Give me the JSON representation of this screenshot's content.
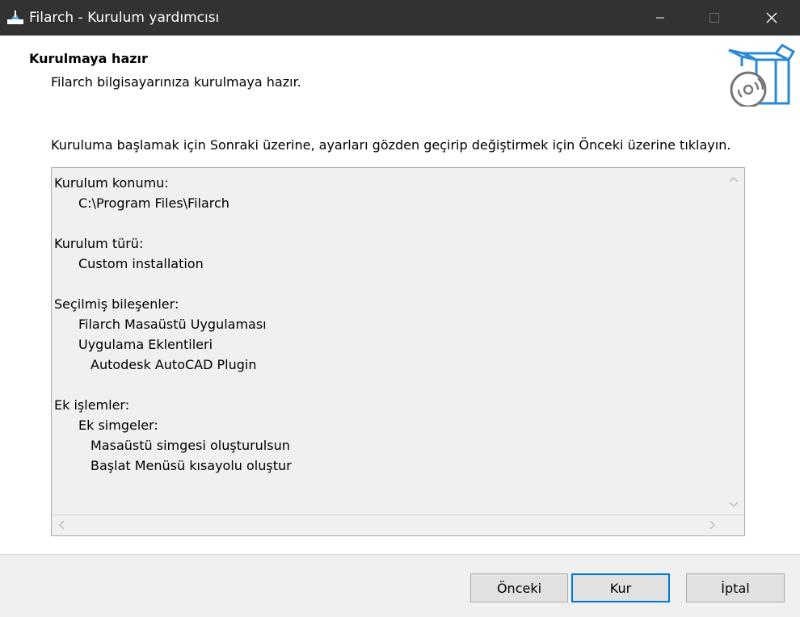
{
  "window": {
    "title": "Filarch - Kurulum yardımcısı",
    "app_icon": "installer-icon",
    "controls": [
      "minimize-icon",
      "maximize-icon",
      "close-icon"
    ]
  },
  "header": {
    "title": "Kurulmaya hazır",
    "subtitle": "Filarch bilgisayarınıza kurulmaya hazır.",
    "icon": "setup-box-cd-icon"
  },
  "content": {
    "instruction": "Kuruluma başlamak için Sonraki üzerine, ayarları gözden geçirip değiştirmek için Önceki üzerine tıklayın.",
    "memo_lines": [
      {
        "indent": 0,
        "text": "Kurulum konumu:"
      },
      {
        "indent": 1,
        "text": "C:\\Program Files\\Filarch"
      },
      {
        "indent": 0,
        "text": ""
      },
      {
        "indent": 0,
        "text": "Kurulum türü:"
      },
      {
        "indent": 1,
        "text": "Custom installation"
      },
      {
        "indent": 0,
        "text": ""
      },
      {
        "indent": 0,
        "text": "Seçilmiş bileşenler:"
      },
      {
        "indent": 1,
        "text": "Filarch Masaüstü Uygulaması"
      },
      {
        "indent": 1,
        "text": "Uygulama Eklentileri"
      },
      {
        "indent": 2,
        "text": "Autodesk AutoCAD Plugin"
      },
      {
        "indent": 0,
        "text": ""
      },
      {
        "indent": 0,
        "text": "Ek işlemler:"
      },
      {
        "indent": 1,
        "text": "Ek simgeler:"
      },
      {
        "indent": 2,
        "text": "Masaüstü simgesi oluşturulsun"
      },
      {
        "indent": 2,
        "text": "Başlat Menüsü kısayolu oluştur"
      }
    ]
  },
  "buttons": {
    "back": "Önceki",
    "install": "Kur",
    "cancel": "İptal"
  },
  "colors": {
    "titlebar": "#323232",
    "accent": "#0078d7",
    "icon_blue": "#2a8ad4"
  }
}
